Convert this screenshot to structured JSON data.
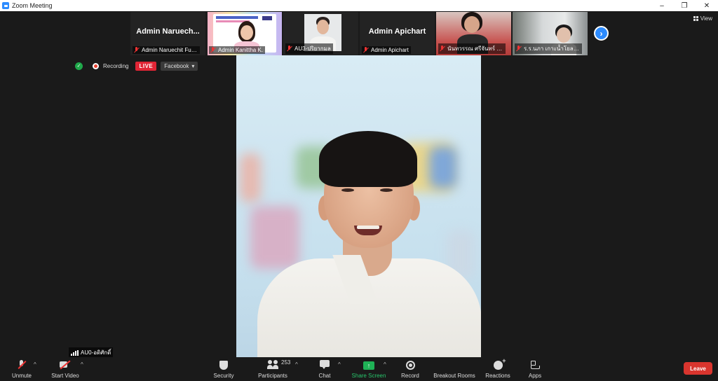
{
  "window": {
    "title": "Zoom Meeting",
    "minimize": "–",
    "maximize": "❐",
    "close": "✕"
  },
  "view": {
    "label": "View"
  },
  "participants_strip": [
    {
      "big_name": "Admin  Naruech...",
      "label": "Admin Naruechit Funp..."
    },
    {
      "label": "Admin Kanittha K."
    },
    {
      "label": "AU3-ปริยากมล"
    },
    {
      "big_name": "Admin Apichart",
      "label": "Admin Apichart"
    },
    {
      "label": "นันทวรรณ  ศรีจันทร์ โรงเรี..."
    },
    {
      "label": "ร.ร.นภา เกาะน้ำโยล - โร..."
    }
  ],
  "next_arrow": "›",
  "recording": {
    "label": "Recording",
    "live": "LIVE",
    "platform": "Facebook",
    "platform_caret": "▾"
  },
  "self_view": {
    "name": "AU0-อดิศักดิ์"
  },
  "toolbar": {
    "unmute": "Unmute",
    "start_video": "Start Video",
    "security": "Security",
    "participants": "Participants",
    "participants_count": "253",
    "chat": "Chat",
    "share_screen": "Share Screen",
    "share_arrow": "↑",
    "record": "Record",
    "breakout_rooms": "Breakout Rooms",
    "reactions": "Reactions",
    "apps": "Apps",
    "leave": "Leave",
    "caret": "^"
  }
}
